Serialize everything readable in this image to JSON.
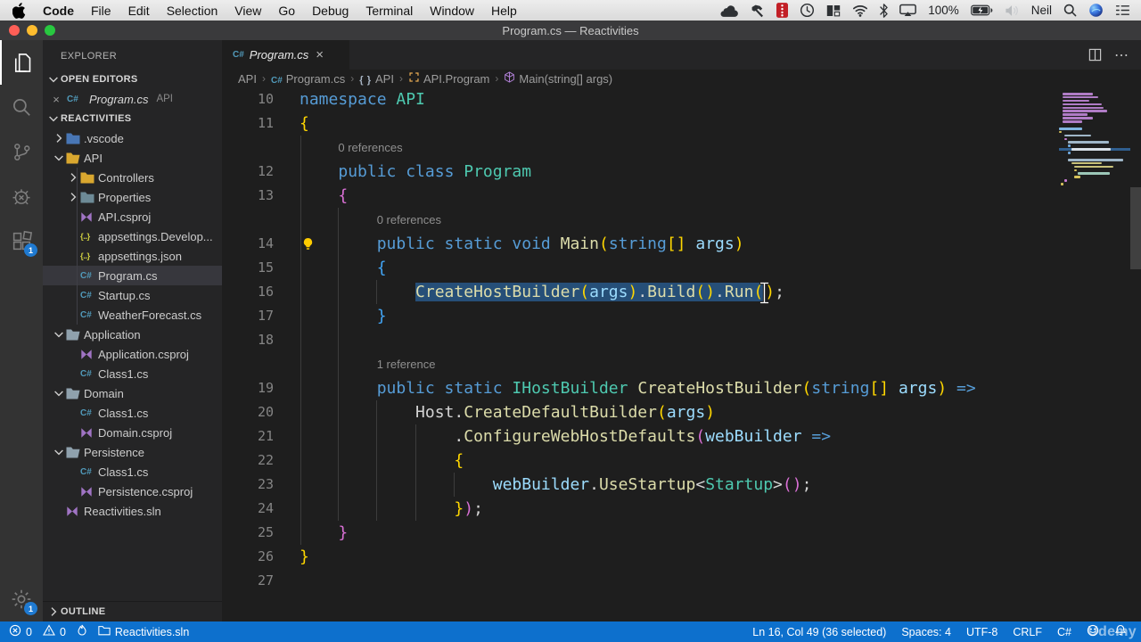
{
  "menu_bar": {
    "items": [
      "Code",
      "File",
      "Edit",
      "Selection",
      "View",
      "Go",
      "Debug",
      "Terminal",
      "Window",
      "Help"
    ],
    "status_items": [
      {
        "icon": "cloud"
      },
      {
        "icon": "hammer"
      },
      {
        "icon": "film"
      },
      {
        "icon": "time-machine"
      },
      {
        "icon": "window-manager"
      },
      {
        "icon": "wifi"
      },
      {
        "icon": "bluetooth"
      },
      {
        "icon": "airplay"
      },
      {
        "text": "100%"
      },
      {
        "icon": "battery-charging"
      },
      {
        "icon": "volume-muted"
      },
      {
        "text": "Neil"
      },
      {
        "icon": "spotlight"
      },
      {
        "icon": "siri"
      },
      {
        "icon": "notification-list"
      }
    ]
  },
  "title_bar": {
    "title": "Program.cs — Reactivities"
  },
  "activity_bar": {
    "top": [
      {
        "name": "explorer",
        "active": true
      },
      {
        "name": "search"
      },
      {
        "name": "source-control"
      },
      {
        "name": "run-debug"
      },
      {
        "name": "extensions",
        "badge": "1"
      }
    ],
    "bottom": [
      {
        "name": "manage",
        "badge": "1"
      }
    ]
  },
  "sidebar": {
    "title": "EXPLORER",
    "sections": {
      "open_editors": "OPEN EDITORS",
      "workspace": "REACTIVITIES",
      "outline": "OUTLINE"
    },
    "open_editor_items": [
      {
        "label": "Program.cs",
        "detail": "API",
        "icon": "cs",
        "close": "×"
      }
    ],
    "tree": [
      {
        "label": ".vscode",
        "icon": "folder-vscode",
        "level": 0,
        "chevron": "right"
      },
      {
        "label": "API",
        "icon": "folder-open-gold",
        "level": 0,
        "chevron": "down"
      },
      {
        "label": "Controllers",
        "icon": "folder-gold",
        "level": 1,
        "chevron": "right"
      },
      {
        "label": "Properties",
        "icon": "folder-slate",
        "level": 1,
        "chevron": "right"
      },
      {
        "label": "API.csproj",
        "icon": "csproj",
        "level": 1
      },
      {
        "label": "appsettings.Develop...",
        "icon": "json",
        "level": 1
      },
      {
        "label": "appsettings.json",
        "icon": "json",
        "level": 1
      },
      {
        "label": "Program.cs",
        "icon": "cs",
        "level": 1,
        "selected": true
      },
      {
        "label": "Startup.cs",
        "icon": "cs",
        "level": 1
      },
      {
        "label": "WeatherForecast.cs",
        "icon": "cs",
        "level": 1
      },
      {
        "label": "Application",
        "icon": "folder-open-gray",
        "level": 0,
        "chevron": "down"
      },
      {
        "label": "Application.csproj",
        "icon": "csproj",
        "level": 1
      },
      {
        "label": "Class1.cs",
        "icon": "cs",
        "level": 1
      },
      {
        "label": "Domain",
        "icon": "folder-open-gray",
        "level": 0,
        "chevron": "down"
      },
      {
        "label": "Class1.cs",
        "icon": "cs",
        "level": 1
      },
      {
        "label": "Domain.csproj",
        "icon": "csproj",
        "level": 1
      },
      {
        "label": "Persistence",
        "icon": "folder-open-gray",
        "level": 0,
        "chevron": "down"
      },
      {
        "label": "Class1.cs",
        "icon": "cs",
        "level": 1
      },
      {
        "label": "Persistence.csproj",
        "icon": "csproj",
        "level": 1
      },
      {
        "label": "Reactivities.sln",
        "icon": "sln",
        "level": 0
      }
    ]
  },
  "editor": {
    "tab": {
      "label": "Program.cs",
      "close": "×"
    },
    "breadcrumbs": [
      {
        "label": "API"
      },
      {
        "label": "Program.cs",
        "icon": "cs"
      },
      {
        "label": "API",
        "icon": "namespace"
      },
      {
        "label": "API.Program",
        "icon": "class"
      },
      {
        "label": "Main(string[] args)",
        "icon": "method"
      }
    ],
    "code": {
      "rows": [
        {
          "n": "10",
          "t": [
            [
              "kw",
              "namespace "
            ],
            [
              "ty",
              "API"
            ]
          ]
        },
        {
          "n": "11",
          "t": [
            [
              "b1",
              "{"
            ]
          ]
        },
        {
          "lens": "0 references",
          "pad": 4
        },
        {
          "n": "12",
          "t": [
            [
              "pl",
              "    "
            ],
            [
              "kw",
              "public class "
            ],
            [
              "ty",
              "Program"
            ]
          ]
        },
        {
          "n": "13",
          "t": [
            [
              "pl",
              "    "
            ],
            [
              "b2",
              "{"
            ]
          ]
        },
        {
          "lens": "0 references",
          "pad": 8
        },
        {
          "n": "14",
          "bulb": true,
          "t": [
            [
              "pl",
              "        "
            ],
            [
              "kw",
              "public static void "
            ],
            [
              "me",
              "Main"
            ],
            [
              "b1",
              "("
            ],
            [
              "kw",
              "string"
            ],
            [
              "b1",
              "[]"
            ],
            [
              "pl",
              " "
            ],
            [
              "va",
              "args"
            ],
            [
              "b1",
              ")"
            ]
          ]
        },
        {
          "n": "15",
          "t": [
            [
              "pl",
              "        "
            ],
            [
              "b3",
              "{"
            ]
          ]
        },
        {
          "n": "16",
          "t": [
            [
              "pl",
              "            "
            ],
            [
              "me",
              "CreateHostBuilder",
              "s"
            ],
            [
              "b1",
              "(",
              "s"
            ],
            [
              "va",
              "args",
              "s"
            ],
            [
              "b1",
              ")",
              "s"
            ],
            [
              "pl",
              ".",
              "s"
            ],
            [
              "me",
              "Build",
              "s"
            ],
            [
              "b1",
              "()",
              "s"
            ],
            [
              "pl",
              ".",
              "s"
            ],
            [
              "me",
              "Run",
              "s"
            ],
            [
              "b1",
              "(",
              "s"
            ],
            [
              "caret",
              ""
            ],
            [
              "b1",
              ")"
            ],
            [
              "pl",
              ";"
            ]
          ]
        },
        {
          "n": "17",
          "t": [
            [
              "pl",
              "        "
            ],
            [
              "b3",
              "}"
            ]
          ]
        },
        {
          "n": "18",
          "t": []
        },
        {
          "lens": "1 reference",
          "pad": 8
        },
        {
          "n": "19",
          "t": [
            [
              "pl",
              "        "
            ],
            [
              "kw",
              "public static "
            ],
            [
              "ty",
              "IHostBuilder"
            ],
            [
              "pl",
              " "
            ],
            [
              "me",
              "CreateHostBuilder"
            ],
            [
              "b1",
              "("
            ],
            [
              "kw",
              "string"
            ],
            [
              "b1",
              "[]"
            ],
            [
              "pl",
              " "
            ],
            [
              "va",
              "args"
            ],
            [
              "b1",
              ")"
            ],
            [
              "kw",
              " =>"
            ]
          ]
        },
        {
          "n": "20",
          "t": [
            [
              "pl",
              "            Host."
            ],
            [
              "me",
              "CreateDefaultBuilder"
            ],
            [
              "b1",
              "("
            ],
            [
              "va",
              "args"
            ],
            [
              "b1",
              ")"
            ]
          ]
        },
        {
          "n": "21",
          "t": [
            [
              "pl",
              "                ."
            ],
            [
              "me",
              "ConfigureWebHostDefaults"
            ],
            [
              "b2",
              "("
            ],
            [
              "va",
              "webBuilder"
            ],
            [
              "kw",
              " =>"
            ]
          ]
        },
        {
          "n": "22",
          "t": [
            [
              "pl",
              "                "
            ],
            [
              "b1",
              "{"
            ]
          ]
        },
        {
          "n": "23",
          "t": [
            [
              "pl",
              "                    "
            ],
            [
              "va",
              "webBuilder"
            ],
            [
              "pl",
              "."
            ],
            [
              "me",
              "UseStartup"
            ],
            [
              "pl",
              "<"
            ],
            [
              "ty",
              "Startup"
            ],
            [
              "pl",
              ">"
            ],
            [
              "b2",
              "()"
            ],
            [
              "pl",
              ";"
            ]
          ]
        },
        {
          "n": "24",
          "t": [
            [
              "pl",
              "                "
            ],
            [
              "b1",
              "}"
            ],
            [
              "b2",
              ")"
            ],
            [
              "pl",
              ";"
            ]
          ]
        },
        {
          "n": "25",
          "t": [
            [
              "pl",
              "    "
            ],
            [
              "b2",
              "}"
            ]
          ]
        },
        {
          "n": "26",
          "t": [
            [
              "b1",
              "}"
            ]
          ]
        },
        {
          "n": "27",
          "t": []
        }
      ]
    }
  },
  "minimap_rows": [
    {
      "c": "#b07cc6",
      "w": 34,
      "i": 4
    },
    {
      "c": "#b07cc6",
      "w": 40,
      "i": 4
    },
    {
      "c": "#b07cc6",
      "w": 30,
      "i": 4
    },
    {
      "c": "#b07cc6",
      "w": 44,
      "i": 4
    },
    {
      "c": "#b07cc6",
      "w": 46,
      "i": 4
    },
    {
      "c": "#b07cc6",
      "w": 50,
      "i": 4
    },
    {
      "c": "#b07cc6",
      "w": 28,
      "i": 4
    },
    {
      "c": "#b07cc6",
      "w": 34,
      "i": 4
    },
    {
      "c": "#b07cc6",
      "w": 22,
      "i": 4
    },
    {
      "c": "",
      "w": 0,
      "i": 0
    },
    {
      "c": "#7fb4e0",
      "w": 26,
      "i": 0
    },
    {
      "c": "#d6c25a",
      "w": 3,
      "i": 0
    },
    {
      "c": "#9fb6c8",
      "w": 30,
      "i": 6
    },
    {
      "c": "#c77bd1",
      "w": 3,
      "i": 6
    },
    {
      "c": "#9fb6c8",
      "w": 46,
      "i": 10
    },
    {
      "c": "#6fa8dc",
      "w": 3,
      "i": 10
    },
    {
      "c": "#d8e0e8",
      "w": 44,
      "i": 14,
      "sel": true
    },
    {
      "c": "#6fa8dc",
      "w": 3,
      "i": 10
    },
    {
      "c": "",
      "w": 0,
      "i": 0
    },
    {
      "c": "#9fb6c8",
      "w": 62,
      "i": 10
    },
    {
      "c": "#c9c27a",
      "w": 34,
      "i": 14
    },
    {
      "c": "#c9c27a",
      "w": 44,
      "i": 17
    },
    {
      "c": "#d6c25a",
      "w": 3,
      "i": 17
    },
    {
      "c": "#9cc7b8",
      "w": 36,
      "i": 21
    },
    {
      "c": "#d6c25a",
      "w": 7,
      "i": 17
    },
    {
      "c": "#c77bd1",
      "w": 3,
      "i": 6
    },
    {
      "c": "#d6c25a",
      "w": 3,
      "i": 2
    }
  ],
  "status_bar": {
    "left": [
      {
        "icon": "error",
        "text": "0"
      },
      {
        "icon": "warning",
        "text": "0"
      },
      {
        "icon": "flame"
      },
      {
        "icon": "folder",
        "text": "Reactivities.sln"
      }
    ],
    "right": [
      {
        "text": "Ln 16, Col 49 (36 selected)"
      },
      {
        "text": "Spaces: 4"
      },
      {
        "text": "UTF-8"
      },
      {
        "text": "CRLF"
      },
      {
        "text": "C#"
      },
      {
        "icon": "feedback"
      },
      {
        "icon": "bell"
      }
    ]
  },
  "watermark": {
    "text": "Udemy"
  }
}
